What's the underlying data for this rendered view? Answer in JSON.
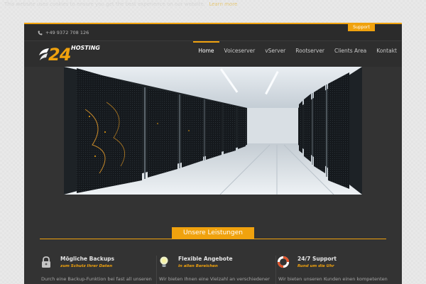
{
  "cookie_bar": {
    "text": "This website uses cookies to ensure you get the best experience on our website.",
    "link": "Learn more"
  },
  "topbar": {
    "phone": "+49 9372 708 126",
    "support_label": "Support"
  },
  "logo": {
    "number": "24",
    "word": "HOSTING"
  },
  "nav": {
    "items": [
      {
        "label": "Home"
      },
      {
        "label": "Voiceserver"
      },
      {
        "label": "vServer"
      },
      {
        "label": "Rootserver"
      },
      {
        "label": "Clients Area"
      },
      {
        "label": "Kontakt"
      }
    ],
    "active": "Home"
  },
  "services": {
    "title": "Unsere Leistungen",
    "items": [
      {
        "icon": "padlock-icon",
        "title": "Mögliche Backups",
        "subtitle": "zum Schutz Ihrer Daten",
        "text": "Durch eine Backup-Funktion bei fast all unseren"
      },
      {
        "icon": "lightbulb-icon",
        "title": "Flexible Angebote",
        "subtitle": "in allen Bereichen",
        "text": "Wir bieten Ihnen eine Vielzahl an verschiedenen"
      },
      {
        "icon": "lifebuoy-icon",
        "title": "24/7 Support",
        "subtitle": "Rund um die Uhr",
        "text": "Wir bieten unseren Kunden einen kompetenten"
      }
    ]
  },
  "colors": {
    "accent": "#f0a20e",
    "page_background": "#333333",
    "header_background": "#2e2e2e"
  }
}
